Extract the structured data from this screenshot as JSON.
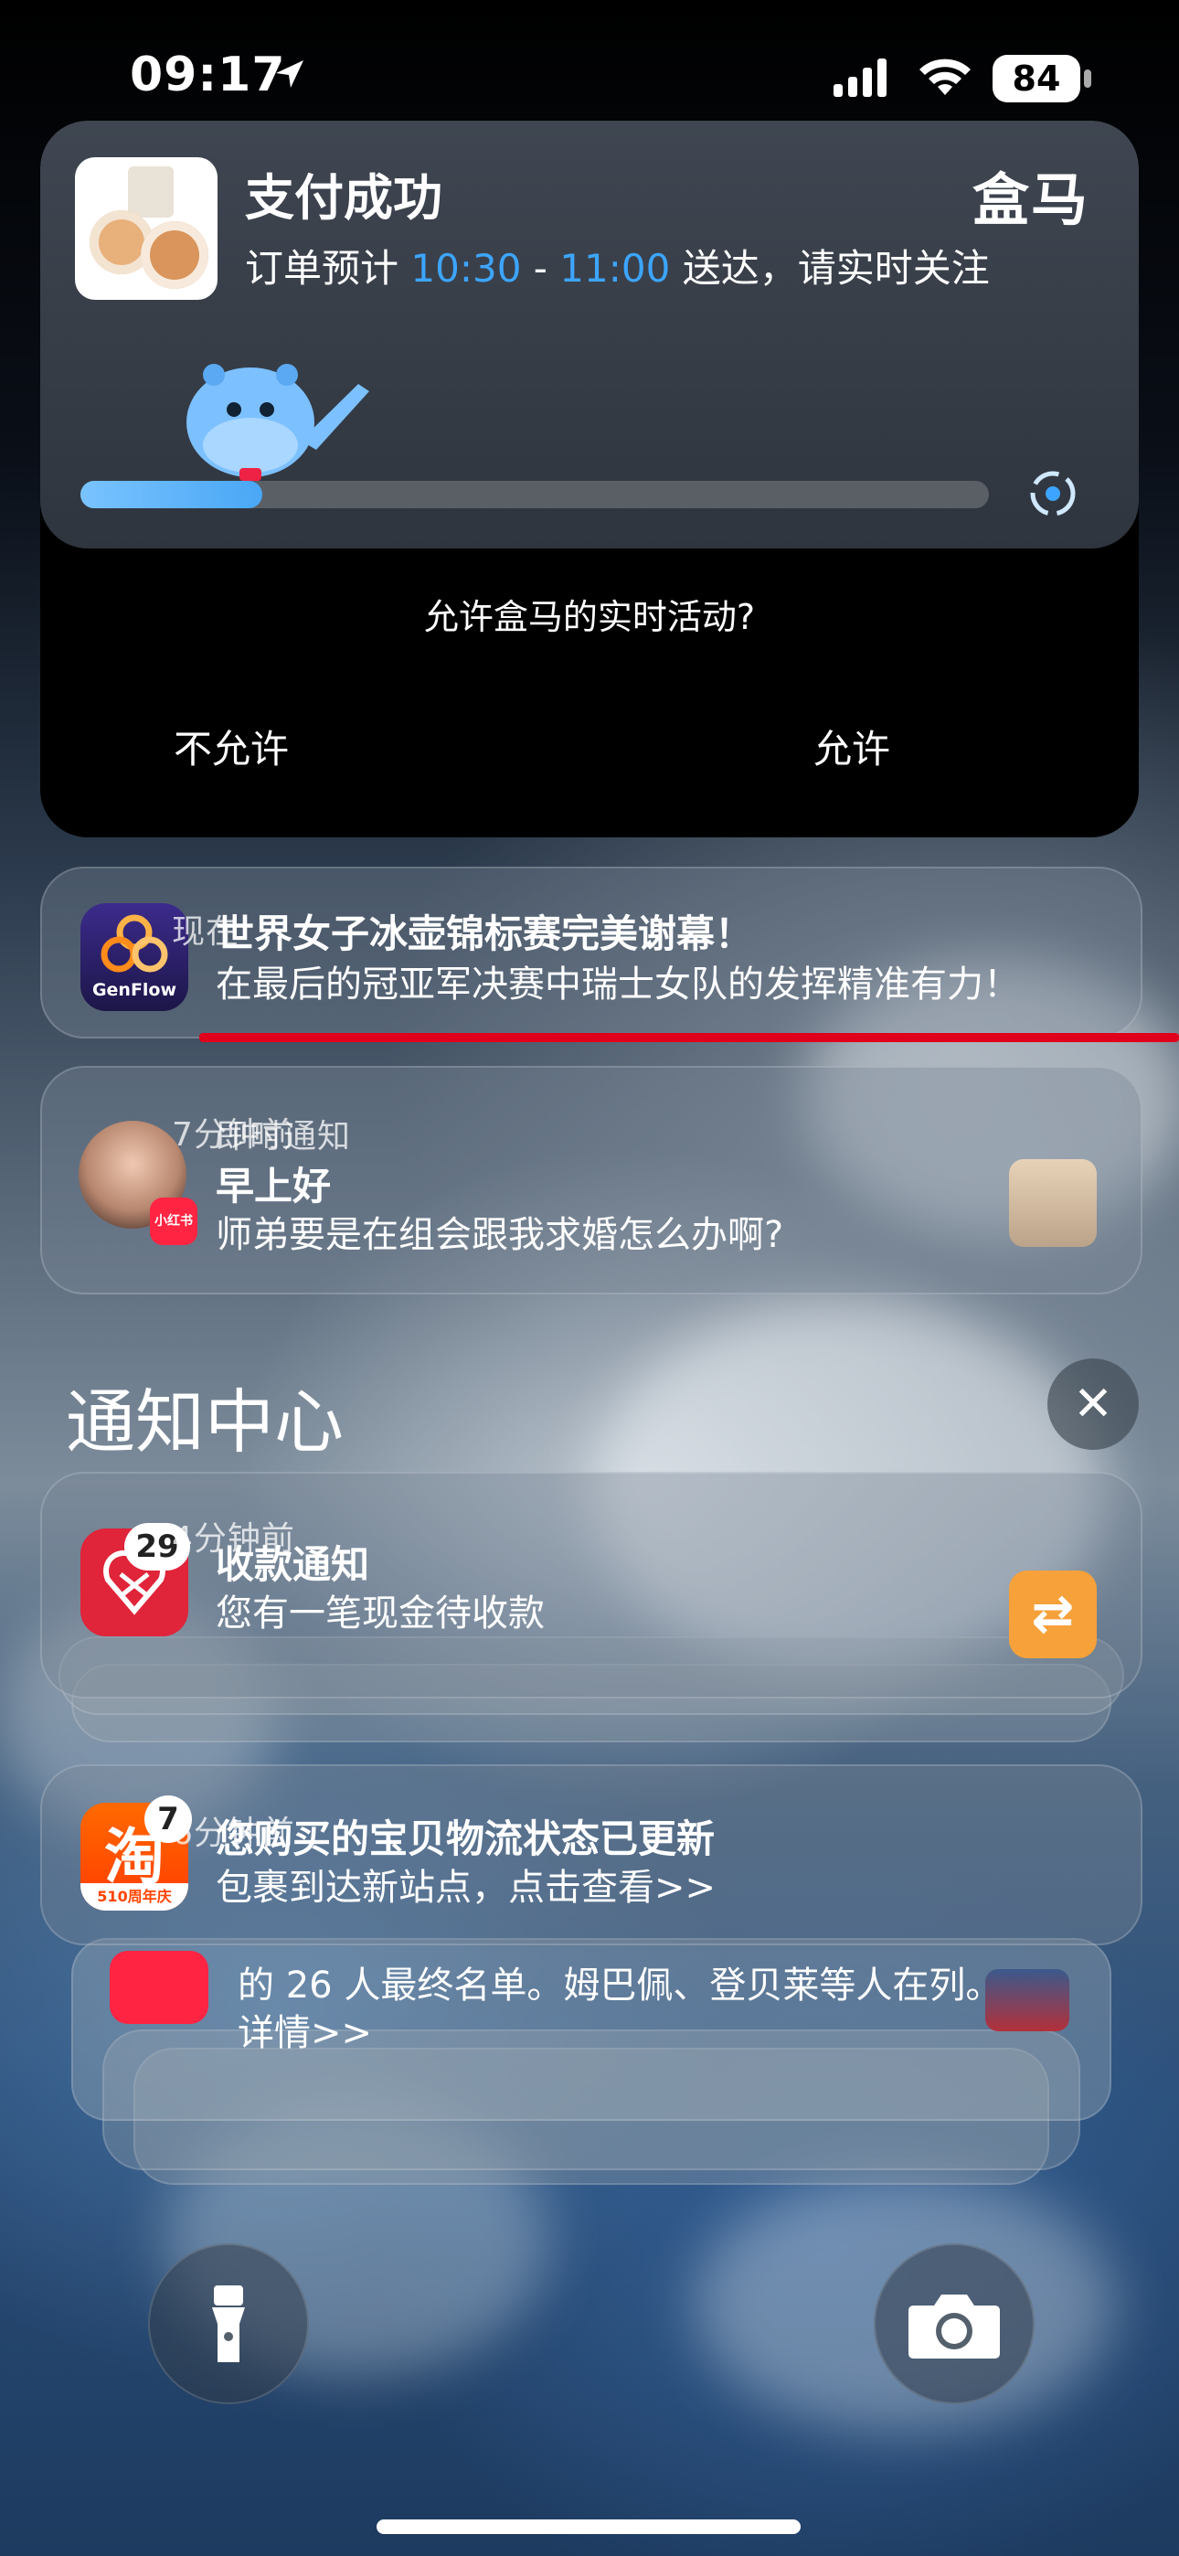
{
  "status_bar": {
    "time": "09:17",
    "battery": "84",
    "icons": [
      "location-arrow-icon",
      "cellular-signal-icon",
      "wifi-icon",
      "battery-icon"
    ]
  },
  "live_activity": {
    "title": "支付成功",
    "brand": "盒马",
    "subtitle_prefix": "订单预计",
    "time_start": "10:30",
    "dash": "-",
    "time_end": "11:00",
    "subtitle_suffix": "送达，请实时关注",
    "progress": 0.2,
    "accent": "#3da5ff",
    "permission_question": "允许盒马的实时活动?",
    "deny_label": "不允许",
    "allow_label": "允许"
  },
  "notifications": [
    {
      "app": "GenFlow",
      "title": "世界女子冰壶锦标赛完美谢幕！",
      "body": "在最后的冠亚军决赛中瑞士女队的发挥精准有力！",
      "time": "现在"
    },
    {
      "app_badge": "小红书",
      "category": "即时通知",
      "title": "早上好",
      "body": "师弟要是在组会跟我求婚怎么办啊?",
      "time": "7分钟前"
    }
  ],
  "notification_center": {
    "title": "通知中心",
    "close_icon": "✕",
    "groups": [
      {
        "badge": "29",
        "title": "收款通知",
        "body": "您有一笔现金待收款",
        "time": "4分钟前",
        "action_icon": "⇄"
      },
      {
        "badge": "7",
        "icon_glyph": "淘",
        "icon_caption": "510周年庆",
        "title": "您购买的宝贝物流状态已更新",
        "body": "包裹到达新站点，点击查看>>",
        "time": "6分钟前"
      }
    ],
    "stacked_preview": {
      "body": "的 26 人最终名单。姆巴佩、登贝莱等人在列。详情>>"
    }
  },
  "lock_controls": [
    "flashlight-icon",
    "camera-icon"
  ]
}
